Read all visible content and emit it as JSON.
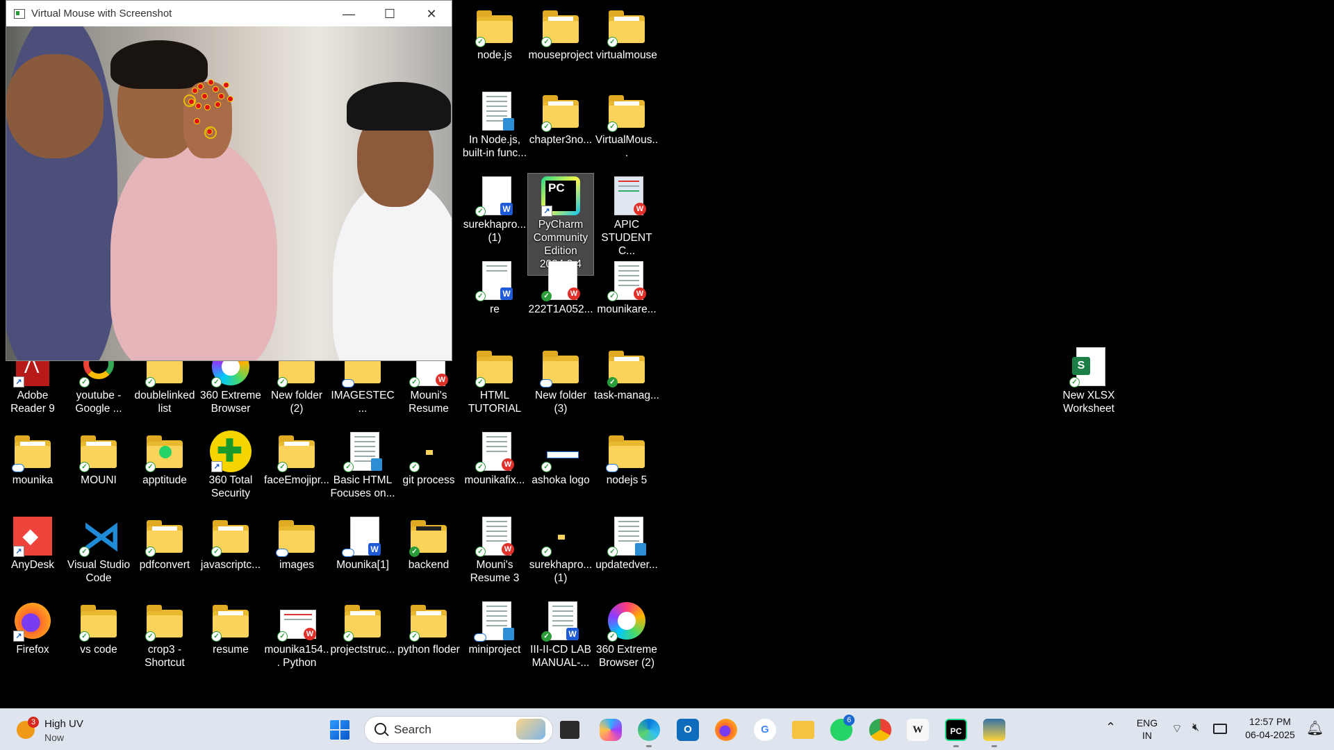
{
  "window": {
    "title": "Virtual Mouse with Screenshot",
    "minimize": "—",
    "maximize": "☐",
    "close": "✕"
  },
  "desktop_icons": {
    "col7": [
      "node.js",
      "In Node.js, built-in func...",
      "surekhapro... (1)",
      "re",
      "HTML TUTORIAL",
      "git process",
      "mounikafix...",
      "Mouni's Resume 3",
      "miniproject"
    ],
    "col8": [
      "mouseproject",
      "chapter3no...",
      "PyCharm Community Edition 2024.3.4",
      "222T1A052...",
      "New folder (3)",
      "ashoka logo",
      "surekhapro... (1)",
      "III-II-CD LAB MANUAL-..."
    ],
    "col9": [
      "virtualmouse",
      "VirtualMous...",
      "APIC STUDENT C...",
      "mounikare...",
      "task-manag...",
      "nodejs 5",
      "updatedver...",
      "360 Extreme Browser (2)"
    ],
    "row5": [
      "Adobe Reader 9",
      "youtube - Google ...",
      "doublelinked list",
      "360 Extreme Browser",
      "New folder (2)",
      "IMAGESTEC...",
      "Mouni's Resume"
    ],
    "row6": [
      "mounika",
      "MOUNI",
      "apptitude",
      "360 Total Security",
      "faceEmojipr...",
      "Basic HTML Focuses on...",
      ""
    ],
    "row7": [
      "AnyDesk",
      "Visual Studio Code",
      "pdfconvert",
      "javascriptc...",
      "images",
      "Mounika[1]",
      "backend"
    ],
    "row8": [
      "Firefox",
      "vs code",
      "crop3 - Shortcut",
      "resume",
      "mounika154... Python",
      "projectstruc...",
      "python floder"
    ],
    "right": [
      "New XLSX Worksheet"
    ]
  },
  "taskbar": {
    "weather_title": "High UV",
    "weather_sub": "Now",
    "weather_badge": "3",
    "search_placeholder": "Search",
    "whatsapp_badge": "6",
    "lang_1": "ENG",
    "lang_2": "IN",
    "time": "12:57 PM",
    "date": "06-04-2025"
  }
}
